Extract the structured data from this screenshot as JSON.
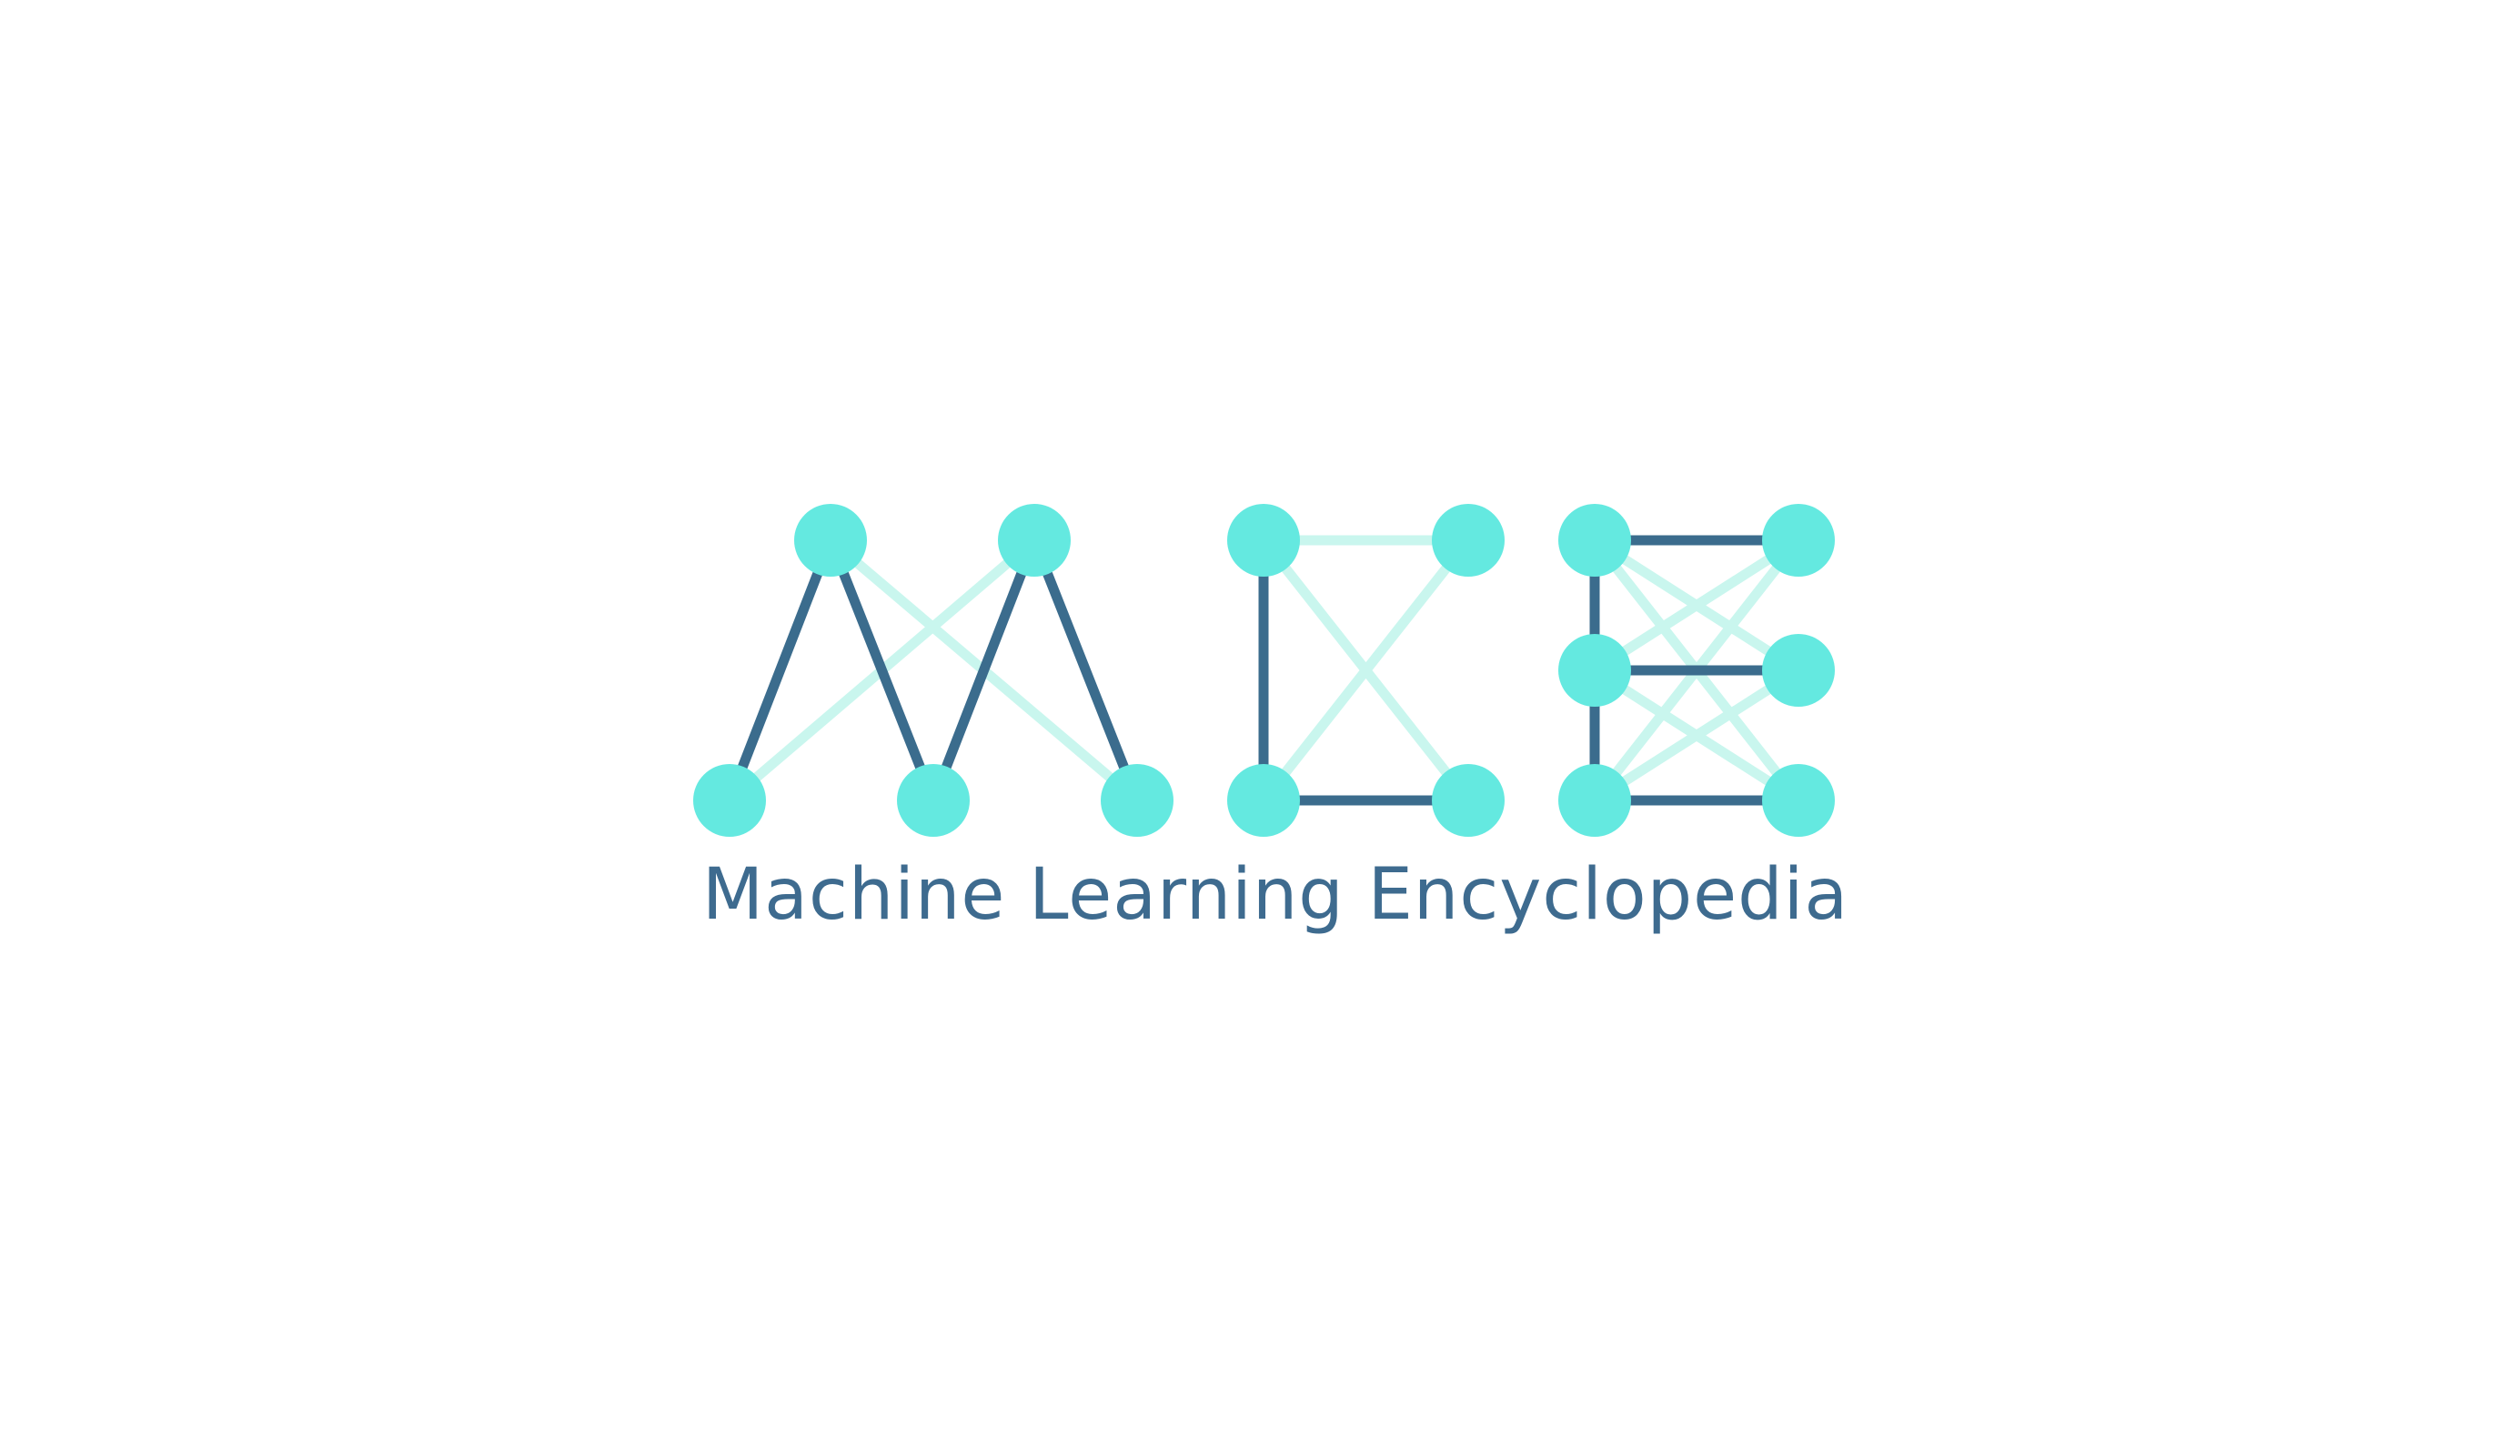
{
  "logo": {
    "wordmark": "MLE",
    "tagline": "Machine Learning Encyclopedia"
  },
  "colors": {
    "background": "#ffffff",
    "node": "#64E9E0",
    "strong_edge": "#3B6C8D",
    "faint_edge": "#C9F6EE",
    "tagline": "#3E6B8F"
  }
}
